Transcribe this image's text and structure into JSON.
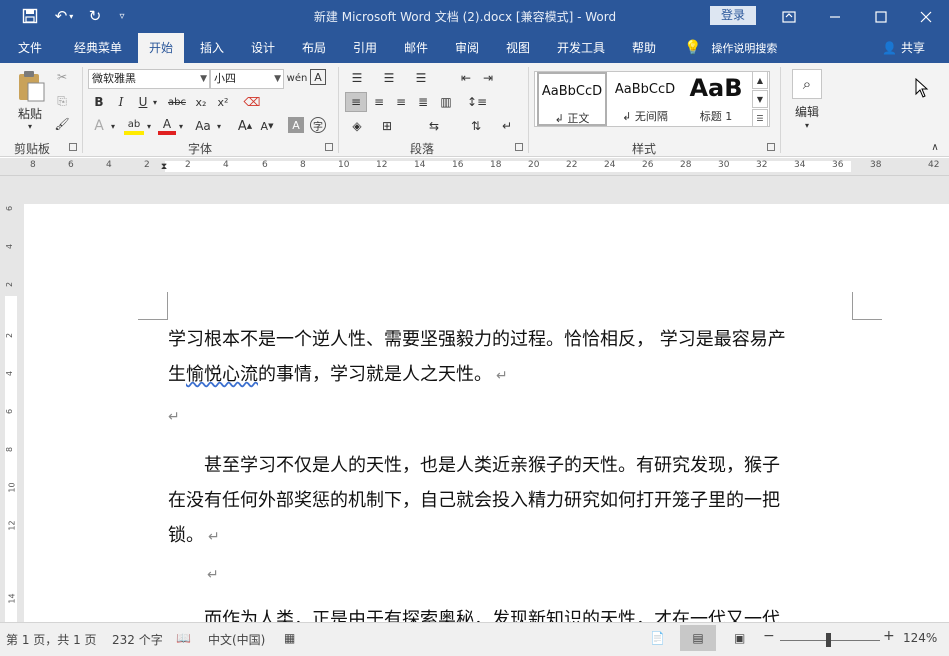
{
  "titlebar": {
    "title": "新建 Microsoft Word 文档 (2).docx [兼容模式] - Word",
    "login": "登录",
    "save_icon": "save-icon",
    "undo_icon": "undo-icon",
    "redo_icon": "redo-icon",
    "customize_icon": "customize-icon"
  },
  "tabs": {
    "items": [
      "文件",
      "经典菜单",
      "开始",
      "插入",
      "设计",
      "布局",
      "引用",
      "邮件",
      "审阅",
      "视图",
      "开发工具",
      "帮助"
    ],
    "search": "操作说明搜索",
    "share": "共享"
  },
  "ribbon": {
    "clipboard": {
      "paste": "粘贴",
      "label": "剪贴板"
    },
    "font": {
      "name": "微软雅黑",
      "size": "小四",
      "label": "字体",
      "bold": "B",
      "italic": "I",
      "underline": "U",
      "strike": "abc",
      "sub": "x₂",
      "sup": "x²",
      "color_a": "A",
      "aa": "Aa"
    },
    "paragraph": {
      "label": "段落"
    },
    "styles": {
      "label": "样式",
      "items": [
        {
          "sample": "AaBbCcD",
          "name": "↲ 正文"
        },
        {
          "sample": "AaBbCcD",
          "name": "↲ 无间隔"
        },
        {
          "sample": "AaB",
          "name": "标题 1"
        }
      ]
    },
    "editing": {
      "label": "编辑"
    }
  },
  "ruler": {
    "h_numbers": [
      "8",
      "6",
      "4",
      "2",
      "2",
      "4",
      "6",
      "8",
      "10",
      "12",
      "14",
      "16",
      "18",
      "20",
      "22",
      "24",
      "26",
      "28",
      "30",
      "32",
      "34",
      "36",
      "38",
      "42"
    ],
    "v_numbers": [
      "6",
      "4",
      "2",
      "2",
      "4",
      "6",
      "8",
      "10",
      "12",
      "14"
    ]
  },
  "document": {
    "p1_l1": "学习根本不是一个逆人性、需要坚强毅力的过程。恰恰相反， 学习是最容易产",
    "p1_l2_a": "生",
    "p1_l2_wavy": "愉悦心流",
    "p1_l2_b": "的事情，学习就是人之天性。",
    "p2_l1": "　　甚至学习不仅是人的天性，也是人类近亲猴子的天性。有研究发现，猴子",
    "p2_l2": "在没有任何外部奖惩的机制下，自己就会投入精力研究如何打开笼子里的一把",
    "p2_l3": "锁。",
    "p3_l1": "　　而作为人类，正是由于有探索奥秘，发现新知识的天性，才在一代又一代",
    "pilcrow": "↵"
  },
  "status": {
    "page": "第 1 页，共 1 页",
    "words": "232 个字",
    "language": "中文(中国)",
    "zoom": "124%",
    "minus": "−",
    "plus": "+"
  }
}
